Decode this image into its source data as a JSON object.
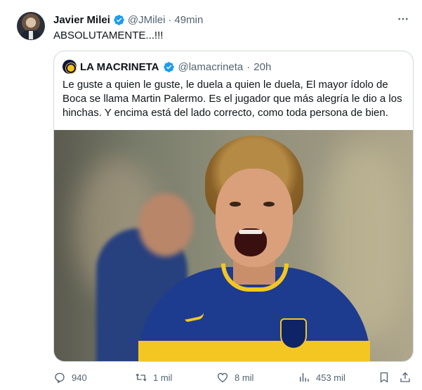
{
  "tweet": {
    "author": {
      "name": "Javier Milei",
      "handle": "@JMilei",
      "time": "49min"
    },
    "text": "ABSOLUTAMENTE...!!!",
    "separator": "·"
  },
  "quote": {
    "author": {
      "name": "LA MACRINETA",
      "handle": "@lamacrineta",
      "time": "20h"
    },
    "text": "Le guste a quien le guste, le duela a quien le duela, El mayor ídolo de Boca se llama Martin Palermo. Es el jugador que más alegría le dio a los hinchas. Y encima está del lado correcto, como toda persona de bien."
  },
  "actions": {
    "replies": "940",
    "reposts": "1 mil",
    "likes": "8 mil",
    "views": "453 mil"
  },
  "icons": [
    "more-icon",
    "verified-icon",
    "reply-icon",
    "repost-icon",
    "like-icon",
    "views-icon",
    "bookmark-icon",
    "share-icon"
  ],
  "colors": {
    "verified": "#1d9bf0",
    "muted": "#536471",
    "border": "#cfd9de"
  }
}
